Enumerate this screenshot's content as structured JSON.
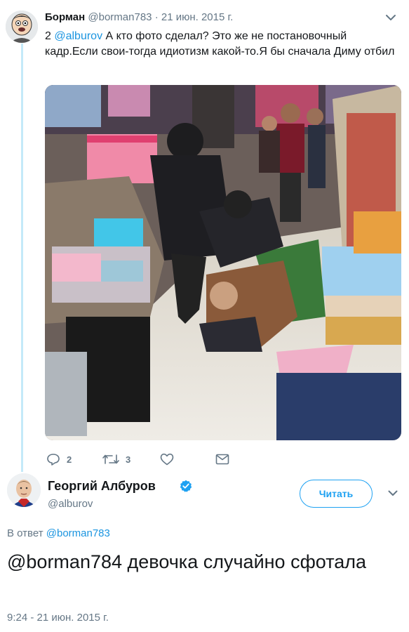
{
  "reply_tweet": {
    "name": "Борман",
    "handle": "@borman783",
    "separator": "·",
    "date": "21 июн. 2015 г.",
    "text_prefix": "2 ",
    "mention": "@alburov",
    "text_body": " А кто фото сделал? Это же не постановочный кадр.Если свои-тогда идиотизм какой-то.Я бы сначала Диму отбил",
    "actions": {
      "reply_count": "2",
      "retweet_count": "3",
      "like_count": "",
      "icons": [
        "reply-icon",
        "retweet-icon",
        "like-icon",
        "message-icon"
      ]
    }
  },
  "main_tweet": {
    "name": "Георгий Албуров",
    "handle": "@alburov",
    "verified": true,
    "follow_label": "Читать",
    "in_reply_prefix": "В ответ ",
    "in_reply_handle": "@borman783",
    "text": "@borman784 девочка случайно сфотала",
    "timestamp": "9:24 - 21 июн. 2015 г."
  },
  "colors": {
    "accent": "#1da1f2",
    "link": "#1b95e0",
    "muted": "#657786",
    "thread_line": "#c4eaf9",
    "verified": "#1da1f2"
  }
}
